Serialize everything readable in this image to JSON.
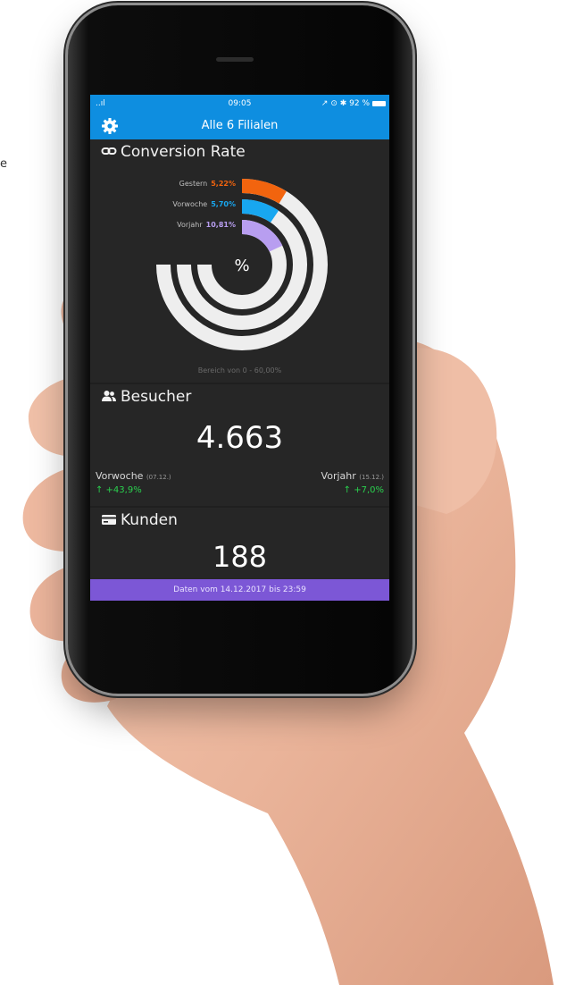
{
  "page_edge_text": "e",
  "status_bar": {
    "signal": "..ıl",
    "time": "09:05",
    "icons": "↗ ⊙ ✱ 92 %"
  },
  "nav": {
    "title": "Alle 6 Filialen",
    "settings_icon": "gear-icon"
  },
  "conversion": {
    "title": "Conversion Rate",
    "center_symbol": "%",
    "range_note": "Bereich von 0 - 60,00%",
    "items": [
      {
        "label": "Gestern",
        "value": "5,22%",
        "fraction": 0.087,
        "color": "#f2640e"
      },
      {
        "label": "Vorwoche",
        "value": "5,70%",
        "fraction": 0.095,
        "color": "#18a7f0"
      },
      {
        "label": "Vorjahr",
        "value": "10,81%",
        "fraction": 0.18,
        "color": "#b89ef0"
      }
    ],
    "track_color": "#eeeeee",
    "chart_data": {
      "type": "radial-bar",
      "categories": [
        "Gestern",
        "Vorwoche",
        "Vorjahr"
      ],
      "values": [
        5.22,
        5.7,
        10.81
      ],
      "ylim": [
        0,
        60
      ]
    }
  },
  "besucher": {
    "title": "Besucher",
    "value": "4.663",
    "left_label": "Vorwoche",
    "left_date": "(07.12.)",
    "left_change": "↑ +43,9%",
    "right_label": "Vorjahr",
    "right_date": "(15.12.)",
    "right_change": "↑ +7,0%"
  },
  "kunden": {
    "title": "Kunden",
    "value": "188"
  },
  "footer": {
    "text": "Daten vom 14.12.2017 bis 23:59"
  }
}
